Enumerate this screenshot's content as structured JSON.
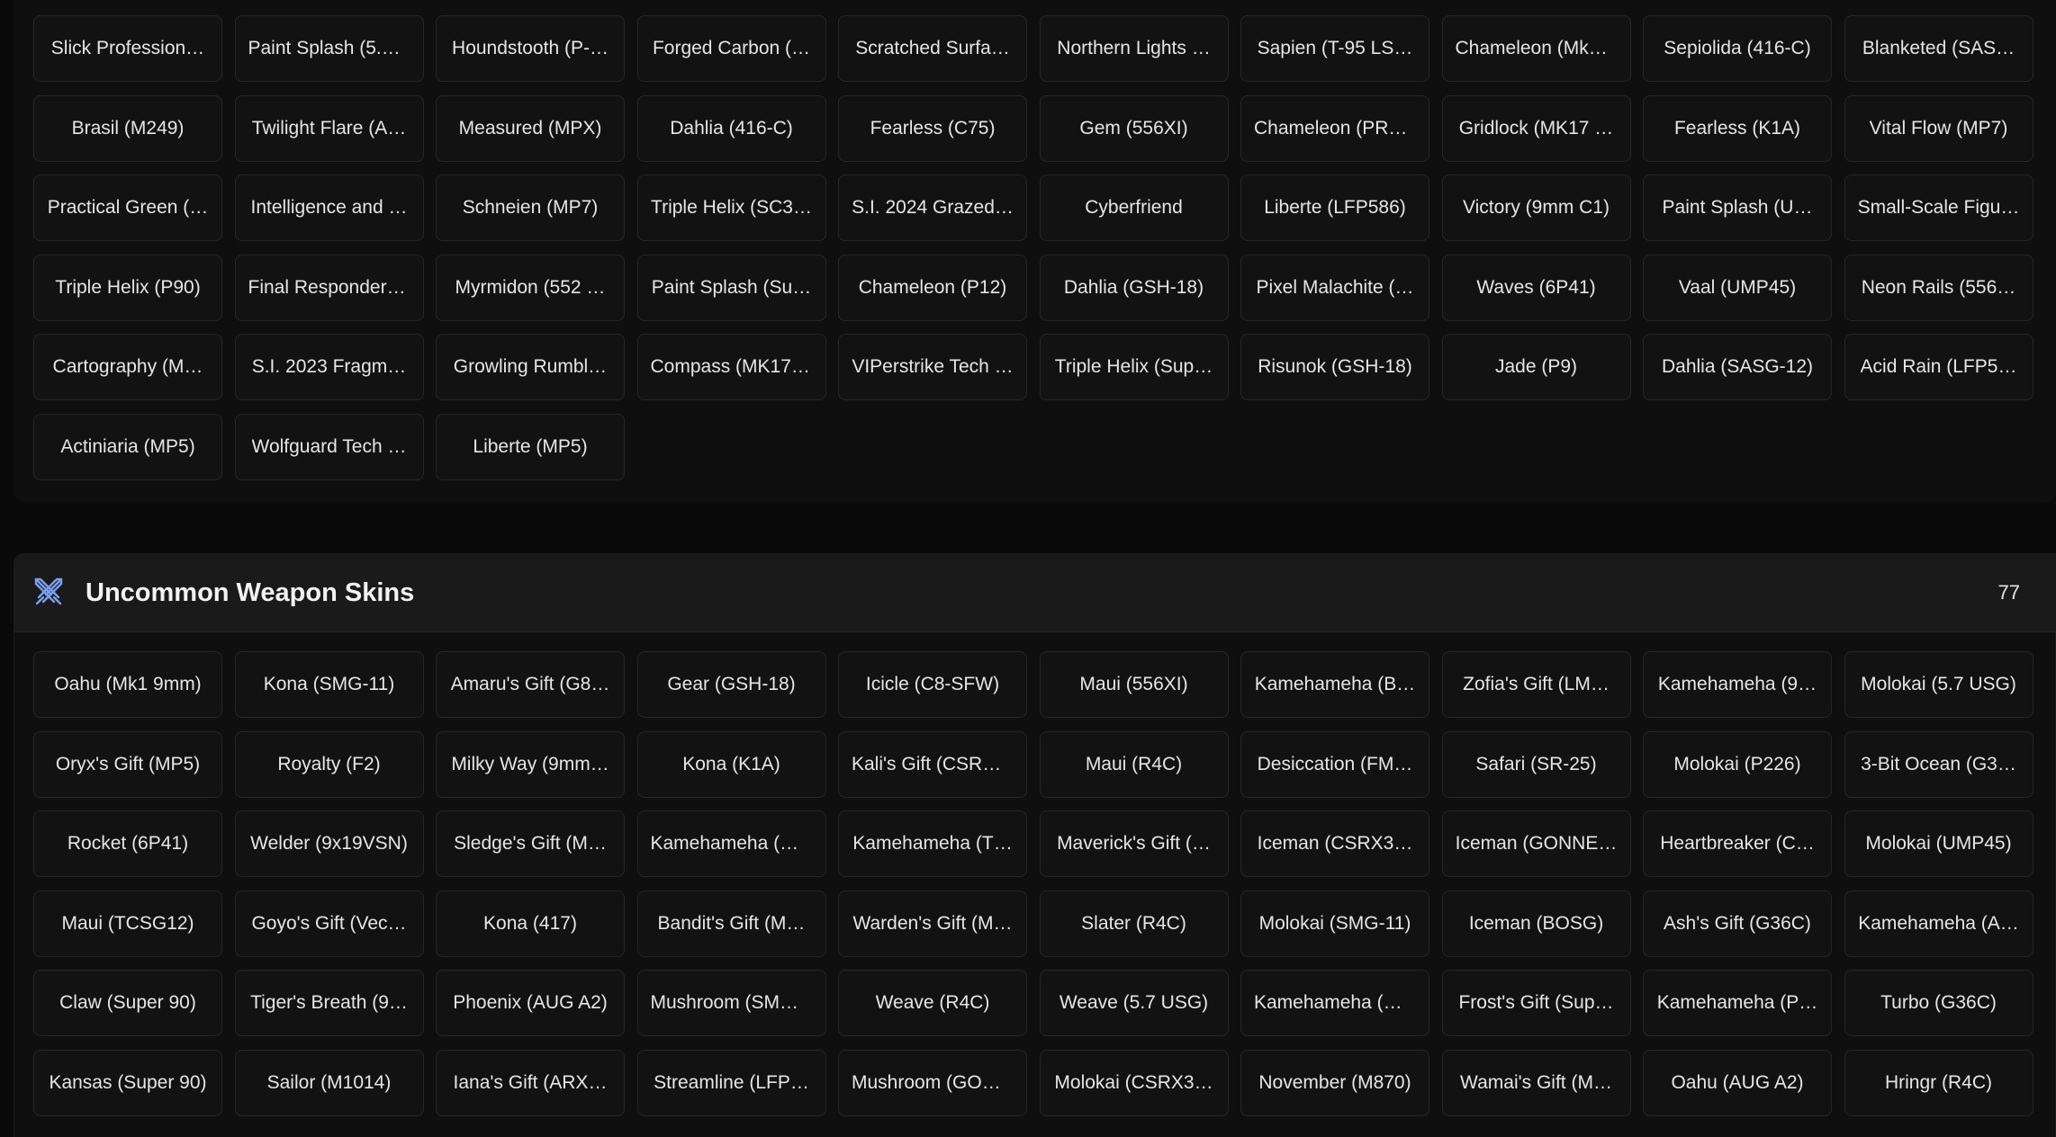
{
  "top_section": {
    "items": [
      "Slick Profession…",
      "Paint Splash (5.7…",
      "Houndstooth (P-…",
      "Forged Carbon (…",
      "Scratched Surfa…",
      "Northern Lights …",
      "Sapien (T-95 LS…",
      "Chameleon (Mk1…",
      "Sepiolida (416-C)",
      "Blanketed (SAS…",
      "Brasil (M249)",
      "Twilight Flare (A…",
      "Measured (MPX)",
      "Dahlia (416-C)",
      "Fearless (C75)",
      "Gem (556XI)",
      "Chameleon (PRB…",
      "Gridlock (MK17 …",
      "Fearless (K1A)",
      "Vital Flow (MP7)",
      "Practical Green (…",
      "Intelligence and …",
      "Schneien (MP7)",
      "Triple Helix (SC3…",
      "S.I. 2024 Grazed…",
      "Cyberfriend",
      "Liberte (LFP586)",
      "Victory (9mm C1)",
      "Paint Splash (U…",
      "Small-Scale Figu…",
      "Triple Helix (P90)",
      "Final Responder …",
      "Myrmidon (552 …",
      "Paint Splash (Su…",
      "Chameleon (P12)",
      "Dahlia (GSH-18)",
      "Pixel Malachite (…",
      "Waves (6P41)",
      "Vaal (UMP45)",
      "Neon Rails (556…",
      "Cartography (M…",
      "S.I. 2023 Fragm…",
      "Growling Rumbl…",
      "Compass (MK17 …",
      "VIPerstrike Tech …",
      "Triple Helix (Sup…",
      "Risunok (GSH-18)",
      "Jade (P9)",
      "Dahlia (SASG-12)",
      "Acid Rain (LFP5…",
      "Actiniaria (MP5)",
      "Wolfguard Tech …",
      "Liberte (MP5)"
    ]
  },
  "uncommon_section": {
    "title": "Uncommon Weapon Skins",
    "count": "77",
    "icon": "crossed-swords-icon",
    "icon_color": "#7b9ff0",
    "items": [
      "Oahu (Mk1 9mm)",
      "Kona (SMG-11)",
      "Amaru's Gift (G8…",
      "Gear (GSH-18)",
      "Icicle (C8-SFW)",
      "Maui (556XI)",
      "Kamehameha (B…",
      "Zofia's Gift (LM…",
      "Kamehameha (9…",
      "Molokai (5.7 USG)",
      "Oryx's Gift (MP5)",
      "Royalty (F2)",
      "Milky Way (9mm…",
      "Kona (K1A)",
      "Kali's Gift (CSRX…",
      "Maui (R4C)",
      "Desiccation (FM…",
      "Safari (SR-25)",
      "Molokai (P226)",
      "3-Bit Ocean (G3…",
      "Rocket (6P41)",
      "Welder (9x19VSN)",
      "Sledge's Gift (M…",
      "Kamehameha (G…",
      "Kamehameha (T…",
      "Maverick's Gift (…",
      "Iceman (CSRX3…",
      "Iceman (GONNE…",
      "Heartbreaker (C…",
      "Molokai (UMP45)",
      "Maui (TCSG12)",
      "Goyo's Gift (Vec…",
      "Kona (417)",
      "Bandit's Gift (M…",
      "Warden's Gift (M…",
      "Slater (R4C)",
      "Molokai (SMG-11)",
      "Iceman (BOSG)",
      "Ash's Gift (G36C)",
      "Kamehameha (A…",
      "Claw (Super 90)",
      "Tiger's Breath (9…",
      "Phoenix (AUG A2)",
      "Mushroom (SMG…",
      "Weave (R4C)",
      "Weave (5.7 USG)",
      "Kamehameha (M…",
      "Frost's Gift (Sup…",
      "Kamehameha (P…",
      "Turbo (G36C)",
      "Kansas (Super 90)",
      "Sailor (M1014)",
      "Iana's Gift (ARX…",
      "Streamline (LFP…",
      "Mushroom (GON…",
      "Molokai (CSRX3…",
      "November (M870)",
      "Wamai's Gift (M…",
      "Oahu (AUG A2)",
      "Hringr (R4C)"
    ]
  }
}
